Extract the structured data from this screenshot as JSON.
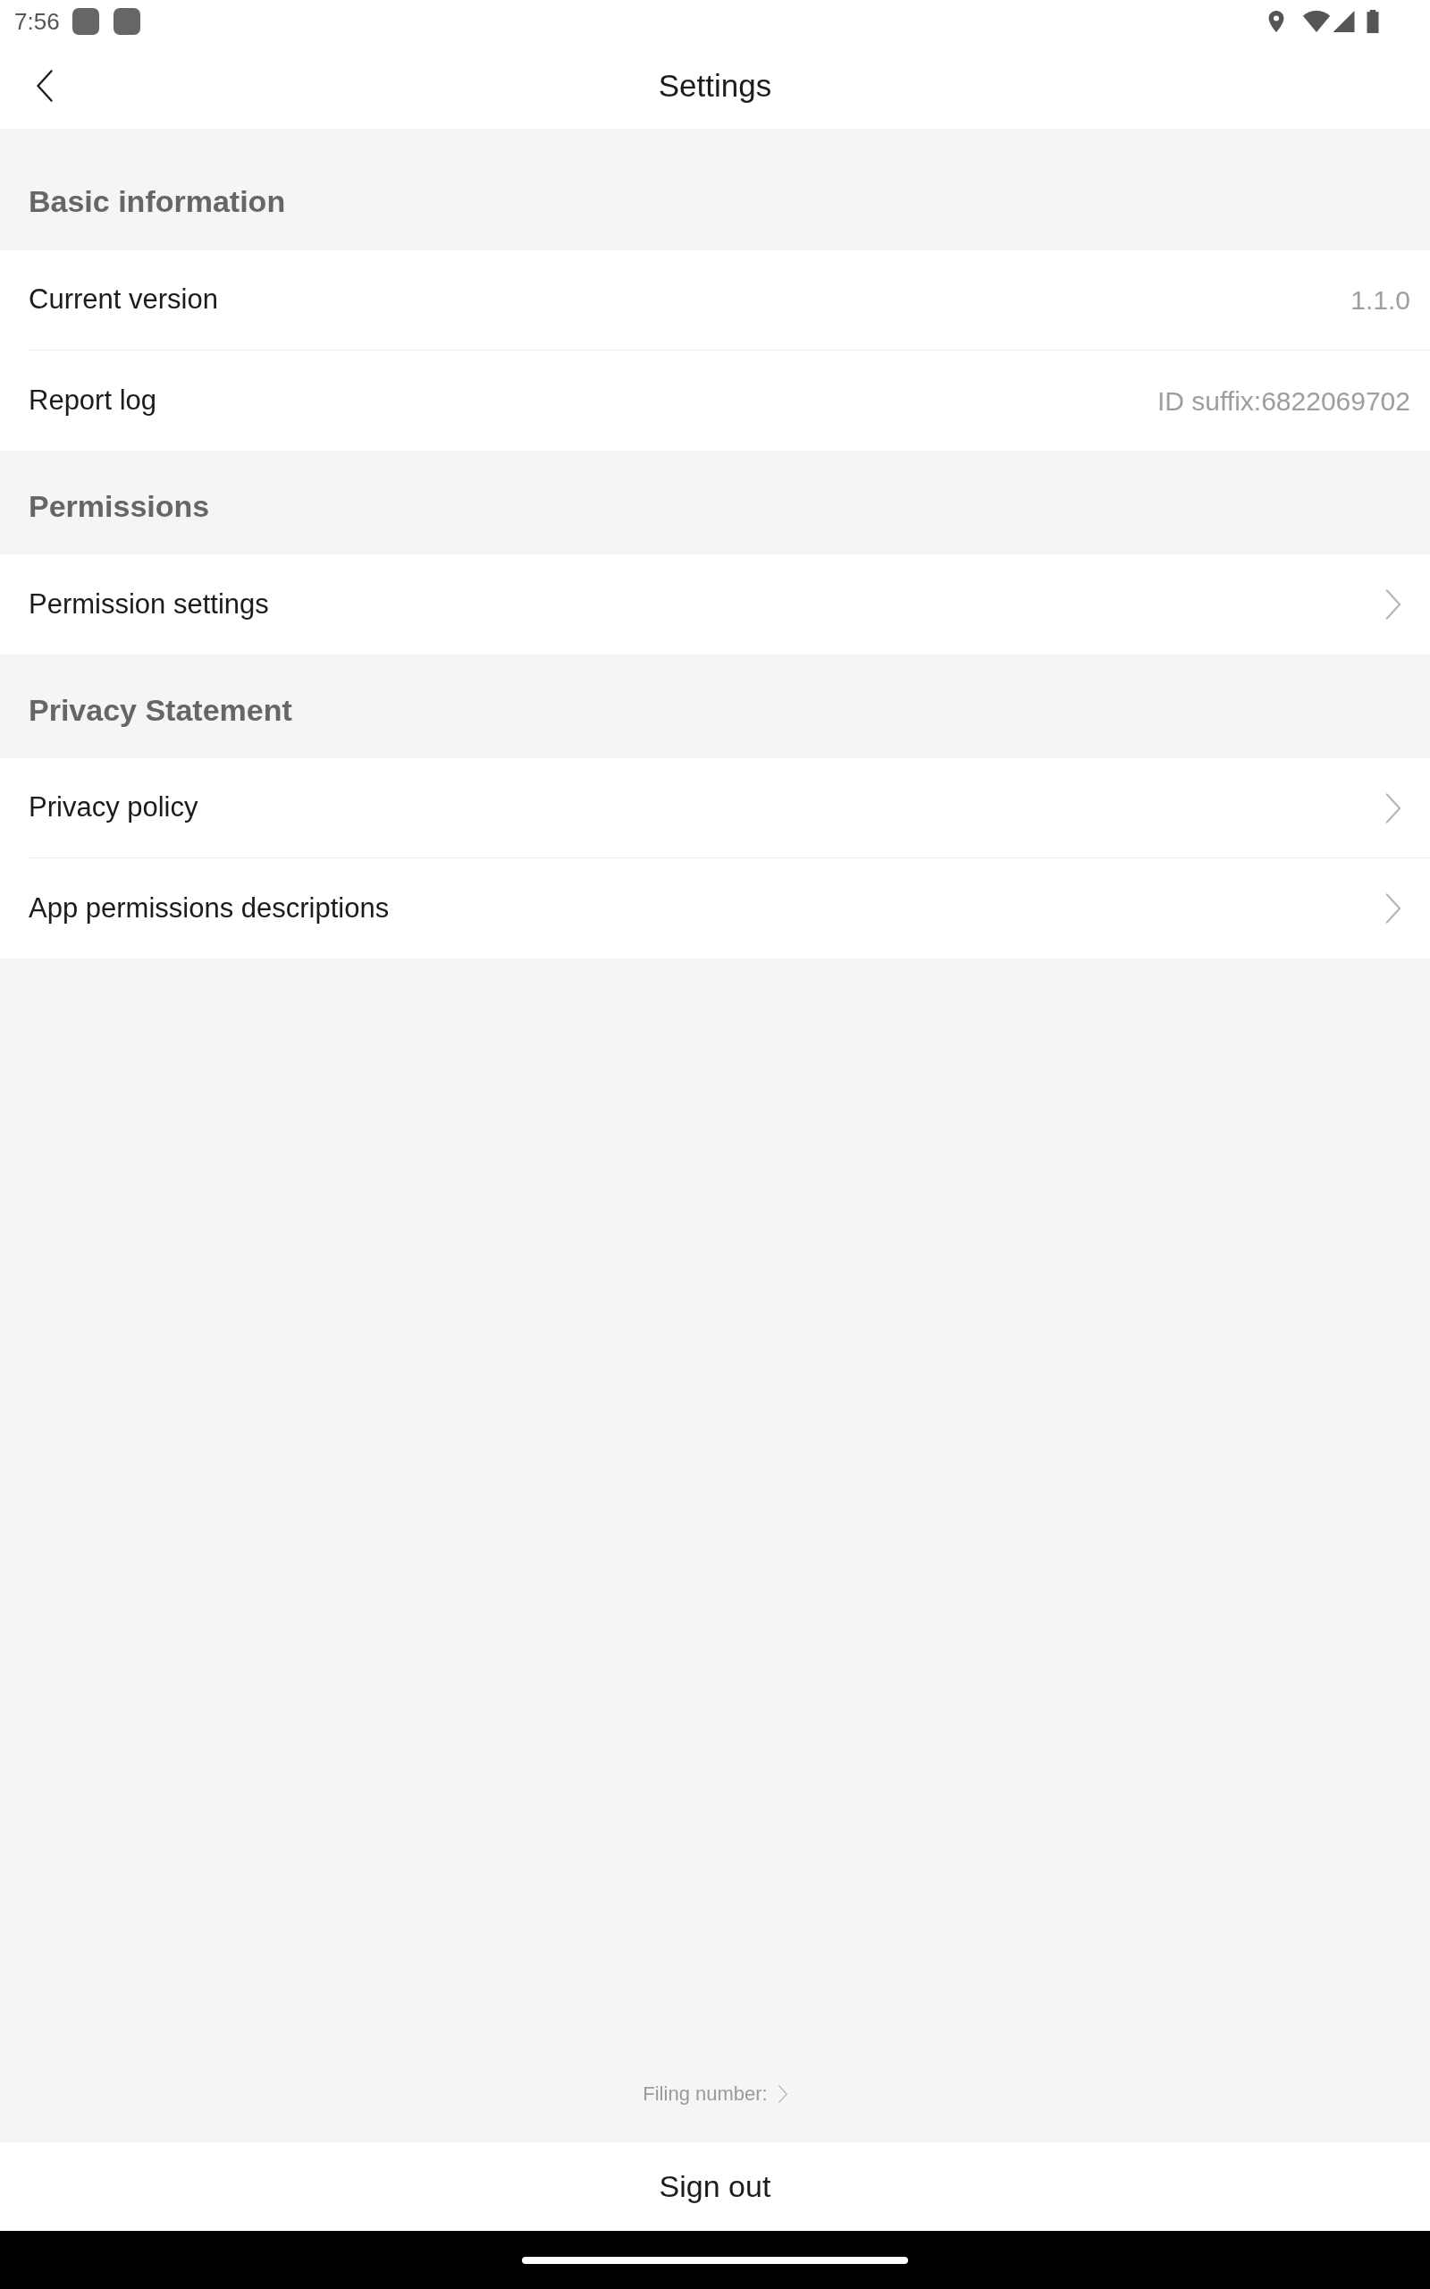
{
  "status_bar": {
    "time": "7:56"
  },
  "header": {
    "title": "Settings"
  },
  "sections": [
    {
      "title": "Basic information",
      "rows": [
        {
          "kind": "info",
          "label": "Current version",
          "value": "1.1.0"
        },
        {
          "kind": "info",
          "label": "Report log",
          "value": "ID suffix:6822069702"
        }
      ]
    },
    {
      "title": "Permissions",
      "rows": [
        {
          "kind": "link",
          "label": "Permission settings"
        }
      ]
    },
    {
      "title": "Privacy Statement",
      "rows": [
        {
          "kind": "link",
          "label": "Privacy policy"
        },
        {
          "kind": "link",
          "label": "App permissions descriptions"
        }
      ]
    }
  ],
  "footer": {
    "filing_number": "Filing number:",
    "sign_out": "Sign out"
  }
}
